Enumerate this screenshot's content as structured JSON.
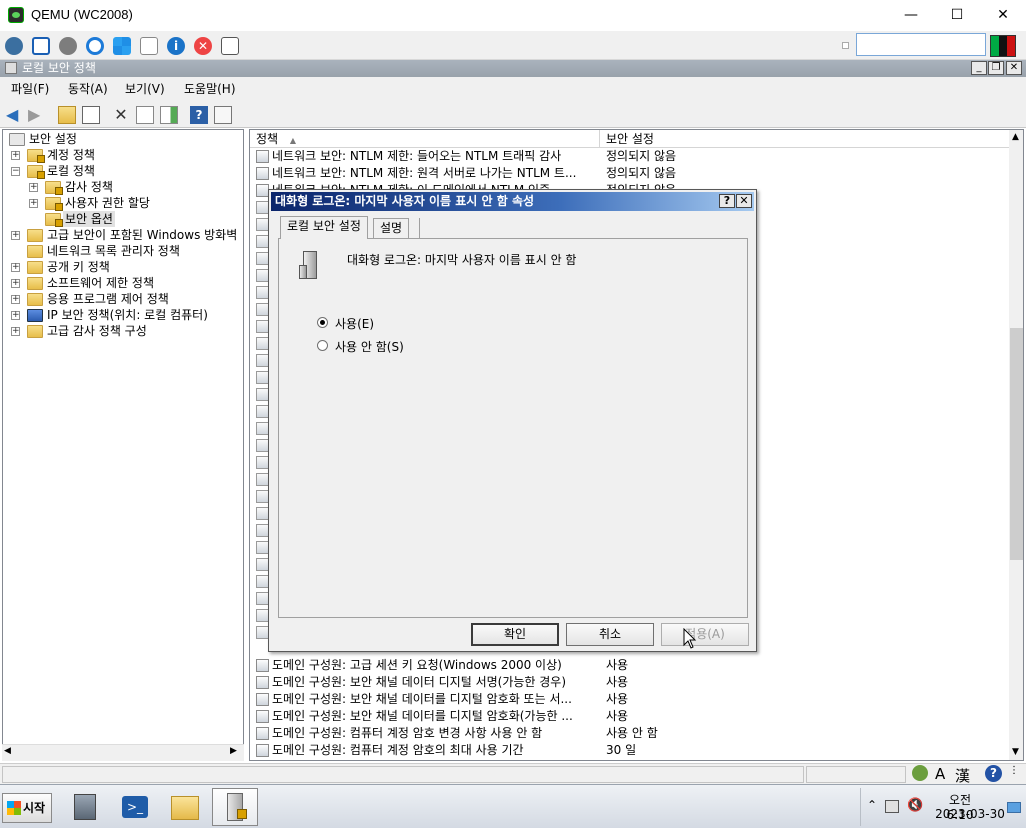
{
  "host": {
    "title": "QEMU (WC2008)",
    "controls": [
      "—",
      "☐",
      "✕"
    ],
    "toolbar_icons": [
      "settings-cube-icon",
      "fullscreen-icon",
      "gear-icon",
      "refresh-icon",
      "windows-logo-icon",
      "keyboard-icon",
      "info-icon",
      "stop-icon",
      "screenshot-icon"
    ],
    "search_value": ""
  },
  "mmc": {
    "title": "로컬 보안 정책",
    "mdi_controls": [
      "_",
      "❐",
      "✕"
    ],
    "menu": [
      "파일(F)",
      "동작(A)",
      "보기(V)",
      "도움말(H)"
    ],
    "toolbar_icons": [
      "back-icon",
      "forward-icon",
      "up-folder-icon",
      "show-tree-icon",
      "delete-icon",
      "properties-icon",
      "export-icon",
      "help-icon",
      "view-icon"
    ]
  },
  "tree": [
    {
      "label": "보안 설정",
      "level": 0,
      "expander": "",
      "selected": false
    },
    {
      "label": "계정 정책",
      "level": 1,
      "expander": "+",
      "selected": false
    },
    {
      "label": "로컬 정책",
      "level": 1,
      "expander": "−",
      "selected": false
    },
    {
      "label": "감사 정책",
      "level": 2,
      "expander": "+",
      "selected": false
    },
    {
      "label": "사용자 권한 할당",
      "level": 2,
      "expander": "+",
      "selected": false
    },
    {
      "label": "보안 옵션",
      "level": 2,
      "expander": "",
      "selected": true
    },
    {
      "label": "고급 보안이 포함된 Windows 방화벽",
      "level": 1,
      "expander": "+",
      "selected": false
    },
    {
      "label": "네트워크 목록 관리자 정책",
      "level": 1,
      "expander": "",
      "selected": false
    },
    {
      "label": "공개 키 정책",
      "level": 1,
      "expander": "+",
      "selected": false
    },
    {
      "label": "소프트웨어 제한 정책",
      "level": 1,
      "expander": "+",
      "selected": false
    },
    {
      "label": "응용 프로그램 제어 정책",
      "level": 1,
      "expander": "+",
      "selected": false
    },
    {
      "label": "IP 보안 정책(위치: 로컬 컴퓨터)",
      "level": 1,
      "expander": "+",
      "selected": false
    },
    {
      "label": "고급 감사 정책 구성",
      "level": 1,
      "expander": "+",
      "selected": false
    }
  ],
  "list": {
    "columns": [
      "정책",
      "보안 설정"
    ],
    "top_rows": [
      {
        "policy": "네트워크 보안: NTLM 제한: 들어오는 NTLM 트래픽 감사",
        "setting": "정의되지 않음"
      },
      {
        "policy": "네트워크 보안: NTLM 제한: 원격 서버로 나가는 NTLM 트...",
        "setting": "정의되지 않음"
      },
      {
        "policy": "네트워크 보안: NTLM 제한: 이 도메인에서 NTLM 인증",
        "setting": "정의되지 않음"
      }
    ],
    "bottom_rows": [
      {
        "policy": "도메인 구성원: 고급 세션 키 요청(Windows 2000 이상)",
        "setting": "사용"
      },
      {
        "policy": "도메인 구성원: 보안 채널 데이터 디지털 서명(가능한 경우)",
        "setting": "사용"
      },
      {
        "policy": "도메인 구성원: 보안 채널 데이터를 디지털 암호화 또는 서...",
        "setting": "사용"
      },
      {
        "policy": "도메인 구성원: 보안 채널 데이터를 디지털 암호화(가능한 ...",
        "setting": "사용"
      },
      {
        "policy": "도메인 구성원: 컴퓨터 계정 암호 변경 사항 사용 안 함",
        "setting": "사용 안 함"
      },
      {
        "policy": "도메인 구성원: 컴퓨터 계정 암호의 최대 사용 기간",
        "setting": "30 일"
      }
    ]
  },
  "dialog": {
    "title": "대화형 로그온: 마지막 사용자 이름 표시 안 함 속성",
    "help": "?",
    "close": "✕",
    "tabs": [
      "로컬 보안 설정",
      "설명"
    ],
    "active_tab": 0,
    "heading": "대화형 로그온: 마지막 사용자 이름 표시 안 함",
    "options": [
      {
        "label": "사용(E)",
        "checked": true
      },
      {
        "label": "사용 안 함(S)",
        "checked": false
      }
    ],
    "buttons": {
      "ok": "확인",
      "cancel": "취소",
      "apply": "적용(A)"
    }
  },
  "status": {
    "ime": [
      "A",
      "漢"
    ],
    "help": "?"
  },
  "taskbar": {
    "start": "시작",
    "apps": [
      "server-manager-icon",
      "powershell-icon",
      "explorer-icon",
      "security-policy-icon"
    ],
    "time": "오전 6:10",
    "date": "2023-03-30",
    "tray_icons": [
      "chevron-up-icon",
      "network-icon",
      "volume-muted-icon",
      "show-desktop-icon"
    ]
  },
  "colors": {
    "dialog_title_start": "#0a246a",
    "dialog_title_end": "#a6caf0",
    "mmc_title": "#99a2ab"
  }
}
